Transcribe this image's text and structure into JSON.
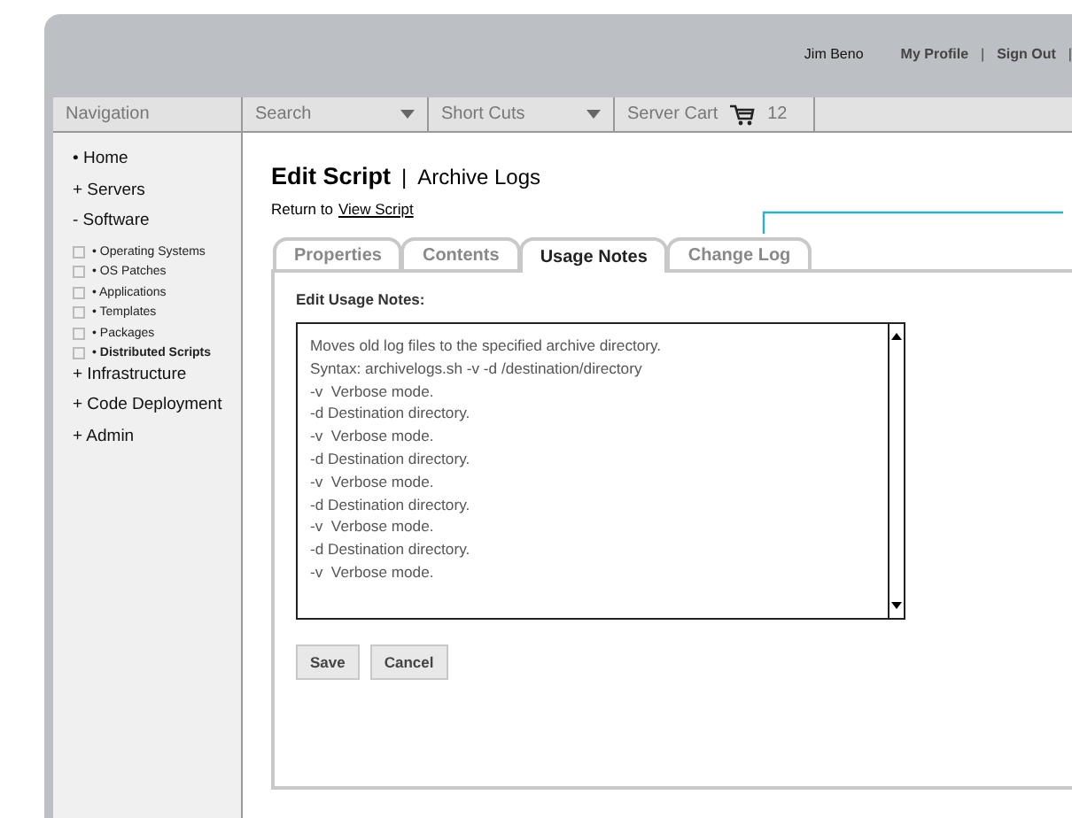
{
  "header": {
    "user": "Jim Beno",
    "links": [
      "My Profile",
      "Sign Out"
    ],
    "separator": "|"
  },
  "toolbar": {
    "navigation": "Navigation",
    "search": {
      "placeholder": "Search"
    },
    "shortcuts": "Short Cuts",
    "cart": {
      "label": "Server Cart",
      "count": "12"
    }
  },
  "sidebar": {
    "items": [
      {
        "marker": "•",
        "label": "Home",
        "selected": false
      },
      {
        "marker": "+",
        "label": "Servers",
        "selected": false
      },
      {
        "marker": "-",
        "label": "Software",
        "selected": false,
        "children": [
          {
            "label": "• Operating Systems",
            "checked": false,
            "selected": false
          },
          {
            "label": "• OS Patches",
            "checked": false,
            "selected": false
          },
          {
            "label": "• Applications",
            "checked": false,
            "selected": false
          },
          {
            "label": "• Templates",
            "checked": false,
            "selected": false
          },
          {
            "label": "• Packages",
            "checked": false,
            "selected": false
          },
          {
            "label": "• Distributed Scripts",
            "checked": false,
            "selected": true
          }
        ]
      },
      {
        "marker": "+",
        "label": "Infrastructure",
        "selected": false
      },
      {
        "marker": "+",
        "label": "Code Deployment",
        "selected": false
      },
      {
        "marker": "+",
        "label": "Admin",
        "selected": false
      }
    ]
  },
  "page": {
    "title": "Edit Script",
    "separator": "|",
    "subtitle": "Archive Logs",
    "return_text": "Return to",
    "return_link": "View Script"
  },
  "tabs": [
    {
      "label": "Properties",
      "selected": false
    },
    {
      "label": "Contents",
      "selected": false
    },
    {
      "label": "Usage Notes",
      "selected": true
    },
    {
      "label": "Change Log",
      "selected": false
    }
  ],
  "form": {
    "label": "Edit Usage Notes:",
    "value": "Moves old log files to the specified archive directory.\nSyntax: archivelogs.sh -v -d /destination/directory\n-v  Verbose mode.\n-d Destination directory.\n-v  Verbose mode.\n-d Destination directory.\n-v  Verbose mode.\n-d Destination directory.\n-v  Verbose mode.\n-d Destination directory.\n-v  Verbose mode.",
    "buttons": [
      "Save",
      "Cancel"
    ]
  }
}
